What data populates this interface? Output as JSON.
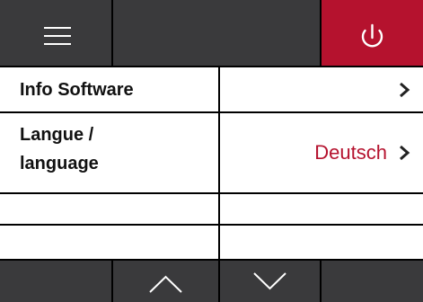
{
  "colors": {
    "accent": "#b5122e",
    "bar": "#3a3a3c",
    "text": "#111111"
  },
  "top_bar": {
    "menu": {
      "icon": "hamburger-menu-icon"
    },
    "power": {
      "icon": "power-icon"
    }
  },
  "menu": {
    "items": [
      {
        "label": "Info Software",
        "value": "",
        "icon": "chevron-right-icon"
      },
      {
        "label": "Langue / language",
        "label_line1": "Langue /",
        "label_line2": "language",
        "value": "Deutsch",
        "icon": "chevron-right-icon"
      },
      {
        "label": "",
        "value": ""
      },
      {
        "label": "",
        "value": ""
      }
    ]
  },
  "bottom_bar": {
    "up": {
      "icon": "chevron-up-icon"
    },
    "down": {
      "icon": "chevron-down-icon"
    }
  }
}
